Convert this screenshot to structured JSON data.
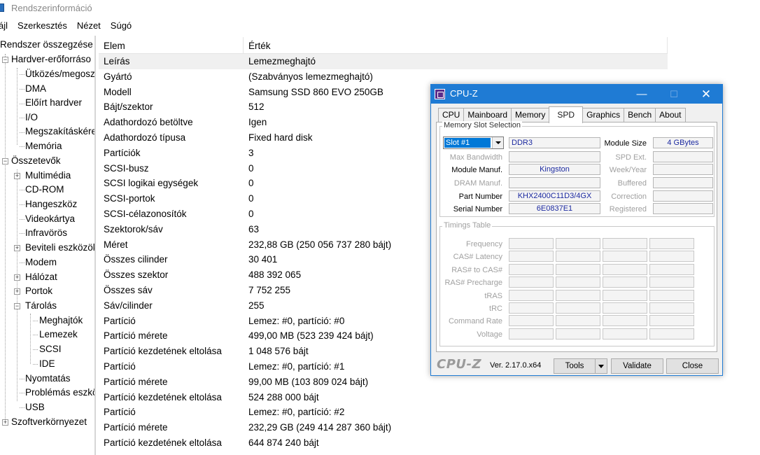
{
  "window": {
    "title": "Rendszerinformáció"
  },
  "menu": [
    "ájl",
    "Szerkesztés",
    "Nézet",
    "Súgó"
  ],
  "tree": [
    {
      "label": "Rendszer összegzése"
    },
    {
      "label": "Hardver-erőforráso"
    },
    {
      "label": "Ütközés/megosz"
    },
    {
      "label": "DMA"
    },
    {
      "label": "Előírt hardver"
    },
    {
      "label": "I/O"
    },
    {
      "label": "Megszakításkére"
    },
    {
      "label": "Memória"
    },
    {
      "label": "Összetevők"
    },
    {
      "label": "Multimédia"
    },
    {
      "label": "CD-ROM"
    },
    {
      "label": "Hangeszköz"
    },
    {
      "label": "Videokártya"
    },
    {
      "label": "Infravörös"
    },
    {
      "label": "Beviteli eszközök"
    },
    {
      "label": "Modem"
    },
    {
      "label": "Hálózat"
    },
    {
      "label": "Portok"
    },
    {
      "label": "Tárolás"
    },
    {
      "label": "Meghajtók"
    },
    {
      "label": "Lemezek"
    },
    {
      "label": "SCSI"
    },
    {
      "label": "IDE"
    },
    {
      "label": "Nyomtatás"
    },
    {
      "label": "Problémás eszkö"
    },
    {
      "label": "USB"
    },
    {
      "label": "Szoftverkörnyezet"
    }
  ],
  "details": {
    "col_item": "Elem",
    "col_value": "Érték",
    "rows": [
      {
        "k": "Leírás",
        "v": "Lemezmeghajtó"
      },
      {
        "k": "Gyártó",
        "v": "(Szabványos lemezmeghajtó)"
      },
      {
        "k": "Modell",
        "v": "Samsung SSD 860 EVO 250GB"
      },
      {
        "k": "Bájt/szektor",
        "v": "512"
      },
      {
        "k": "Adathordozó betöltve",
        "v": "Igen"
      },
      {
        "k": "Adathordozó típusa",
        "v": "Fixed hard disk"
      },
      {
        "k": "Partíciók",
        "v": "3"
      },
      {
        "k": "SCSI-busz",
        "v": "0"
      },
      {
        "k": "SCSI logikai egységek",
        "v": "0"
      },
      {
        "k": "SCSI-portok",
        "v": "0"
      },
      {
        "k": "SCSI-célazonosítók",
        "v": "0"
      },
      {
        "k": "Szektorok/sáv",
        "v": "63"
      },
      {
        "k": "Méret",
        "v": "232,88 GB (250 056 737 280 bájt)"
      },
      {
        "k": "Összes cilinder",
        "v": "30 401"
      },
      {
        "k": "Összes szektor",
        "v": "488 392 065"
      },
      {
        "k": "Összes sáv",
        "v": "7 752 255"
      },
      {
        "k": "Sáv/cilinder",
        "v": "255"
      },
      {
        "k": "Partíció",
        "v": "Lemez: #0, partíció: #0"
      },
      {
        "k": "Partíció mérete",
        "v": "499,00 MB (523 239 424 bájt)"
      },
      {
        "k": "Partíció kezdetének eltolása",
        "v": "1 048 576 bájt"
      },
      {
        "k": "Partíció",
        "v": "Lemez: #0, partíció: #1"
      },
      {
        "k": "Partíció mérete",
        "v": "99,00 MB (103 809 024 bájt)"
      },
      {
        "k": "Partíció kezdetének eltolása",
        "v": "524 288 000 bájt"
      },
      {
        "k": "Partíció",
        "v": "Lemez: #0, partíció: #2"
      },
      {
        "k": "Partíció mérete",
        "v": "232,29 GB (249 414 287 360 bájt)"
      },
      {
        "k": "Partíció kezdetének eltolása",
        "v": "644 874 240 bájt"
      }
    ]
  },
  "cpuz": {
    "title": "CPU-Z",
    "tabs": [
      "CPU",
      "Mainboard",
      "Memory",
      "SPD",
      "Graphics",
      "Bench",
      "About"
    ],
    "active_tab": "SPD",
    "slot_group": "Memory Slot Selection",
    "slot": "Slot #1",
    "ddr": "DDR3",
    "module_size_label": "Module Size",
    "module_size": "4 GBytes",
    "max_bandwidth_label": "Max Bandwidth",
    "max_bandwidth": "",
    "spd_ext_label": "SPD Ext.",
    "spd_ext": "",
    "module_manuf_label": "Module Manuf.",
    "module_manuf": "Kingston",
    "week_year_label": "Week/Year",
    "week_year": "",
    "dram_manuf_label": "DRAM Manuf.",
    "dram_manuf": "",
    "buffered_label": "Buffered",
    "buffered": "",
    "part_number_label": "Part Number",
    "part_number": "KHX2400C11D3/4GX",
    "correction_label": "Correction",
    "correction": "",
    "serial_number_label": "Serial Number",
    "serial_number": "6E0837E1",
    "registered_label": "Registered",
    "registered": "",
    "timings_group": "Timings Table",
    "timings": [
      "Frequency",
      "CAS# Latency",
      "RAS# to CAS#",
      "RAS# Precharge",
      "tRAS",
      "tRC",
      "Command Rate",
      "Voltage"
    ],
    "brand": "CPU-Z",
    "version": "Ver. 2.17.0.x64",
    "tools": "Tools",
    "validate": "Validate",
    "close": "Close"
  }
}
